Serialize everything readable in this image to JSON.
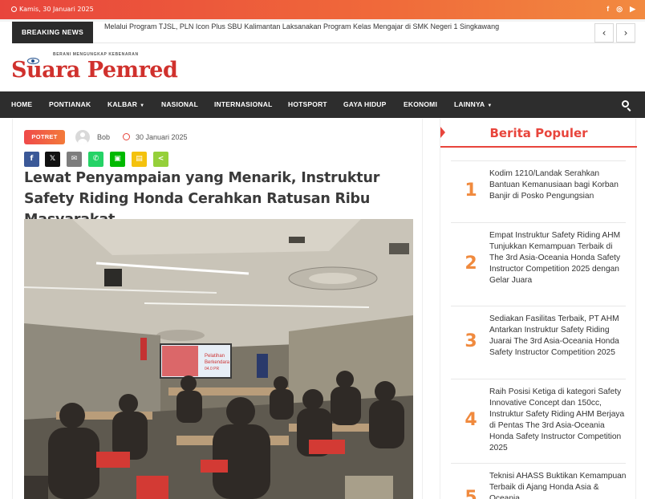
{
  "topbar": {
    "date": "Kamis, 30 Januari 2025",
    "social_icons": [
      "facebook-icon",
      "instagram-icon",
      "youtube-icon"
    ],
    "social_glyphs": [
      "f",
      "◎",
      "▶"
    ]
  },
  "breaking": {
    "label": "BREAKING NEWS",
    "headline": "Melalui Program TJSL, PLN Icon Plus SBU Kalimantan Laksanakan Program Kelas Mengajar di SMK Negeri 1 Singkawang",
    "prev": "‹",
    "next": "›"
  },
  "logo": {
    "tagline": "BERANI MENGUNGKAP KEBENARAN",
    "name": "Suara Pemred"
  },
  "nav": {
    "items": [
      {
        "label": "HOME"
      },
      {
        "label": "PONTIANAK"
      },
      {
        "label": "KALBAR",
        "caret": "▼"
      },
      {
        "label": "NASIONAL"
      },
      {
        "label": "INTERNASIONAL"
      },
      {
        "label": "HOTSPORT"
      },
      {
        "label": "GAYA HIDUP"
      },
      {
        "label": "EKONOMI"
      },
      {
        "label": "LAINNYA",
        "caret": "▼"
      }
    ]
  },
  "article": {
    "category": "POTRET",
    "author": "Bob",
    "date": "30 Januari 2025",
    "share": [
      {
        "icon": "facebook-icon",
        "glyph": "f",
        "color": "#3b5998"
      },
      {
        "icon": "x-icon",
        "glyph": "𝕏",
        "color": "#111111"
      },
      {
        "icon": "email-icon",
        "glyph": "✉",
        "color": "#7d7d7d"
      },
      {
        "icon": "whatsapp-icon",
        "glyph": "✆",
        "color": "#25d366"
      },
      {
        "icon": "line-icon",
        "glyph": "▣",
        "color": "#00b900"
      },
      {
        "icon": "sms-icon",
        "glyph": "▤",
        "color": "#f4c20d"
      },
      {
        "icon": "sharethis-icon",
        "glyph": "<",
        "color": "#95d03a"
      }
    ],
    "title": "Lewat Penyampaian yang Menarik, Instruktur Safety Riding Honda Cerahkan Ratusan Ribu Masyarakat",
    "screen_text": [
      "Pelatihan",
      "Berkendara",
      "04.0 PR"
    ]
  },
  "sidebar": {
    "heading": "Berita Populer",
    "items": [
      {
        "rank": "1",
        "title": "Kodim 1210/Landak Serahkan Bantuan Kemanusiaan bagi Korban Banjir di Posko Pengungsian"
      },
      {
        "rank": "2",
        "title": "Empat Instruktur Safety Riding AHM Tunjukkan Kemampuan Terbaik di The 3rd Asia-Oceania Honda Safety Instructor Competition 2025 dengan Gelar Juara"
      },
      {
        "rank": "3",
        "title": "Sediakan Fasilitas Terbaik, PT AHM Antarkan Instruktur Safety Riding Juarai The 3rd Asia-Oceania Honda Safety Instructor Competition 2025"
      },
      {
        "rank": "4",
        "title": "Raih Posisi Ketiga di kategori Safety Innovative Concept dan 150cc, Instruktur Safety Riding AHM Berjaya di Pentas The 3rd Asia-Oceania Honda Safety Instructor Competition 2025"
      },
      {
        "rank": "5",
        "title": "Teknisi AHASS Buktikan Kemampuan Terbaik di Ajang Honda Asia & Oceania"
      }
    ]
  },
  "colors": {
    "accent": "#e8453c",
    "rank": "#f08a3e",
    "nav_bg": "#2d2d2d"
  }
}
